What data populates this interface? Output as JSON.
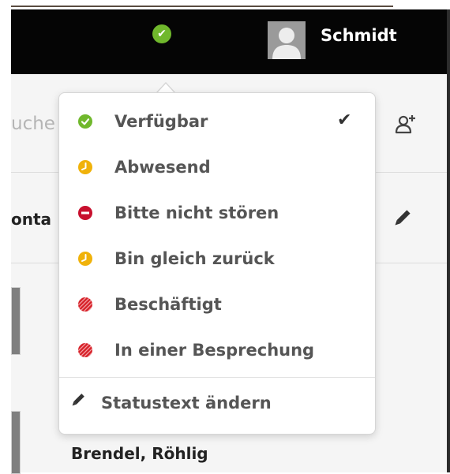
{
  "header": {
    "username": "Schmidt",
    "status_color": "#70b82c"
  },
  "sidebar": {
    "search_partial": "uche",
    "contact_partial": "onta",
    "row_name": "Brendel, Röhlig"
  },
  "status_menu": {
    "items": [
      {
        "label": "Verfügbar",
        "icon": "available-icon",
        "color": "#70b82c",
        "selected": true
      },
      {
        "label": "Abwesend",
        "icon": "away-clock-icon",
        "color": "#f0b20a",
        "selected": false
      },
      {
        "label": "Bitte nicht stören",
        "icon": "do-not-disturb-icon",
        "color": "#c8102e",
        "selected": false
      },
      {
        "label": "Bin gleich zurück",
        "icon": "be-right-back-clock-icon",
        "color": "#f0b20a",
        "selected": false
      },
      {
        "label": "Beschäftigt",
        "icon": "busy-icon",
        "color": "#d62028",
        "selected": false
      },
      {
        "label": "In einer Besprechung",
        "icon": "in-meeting-icon",
        "color": "#d62028",
        "selected": false
      }
    ],
    "edit_label": "Statustext ändern"
  },
  "icons": {
    "checkmark": "✔"
  }
}
